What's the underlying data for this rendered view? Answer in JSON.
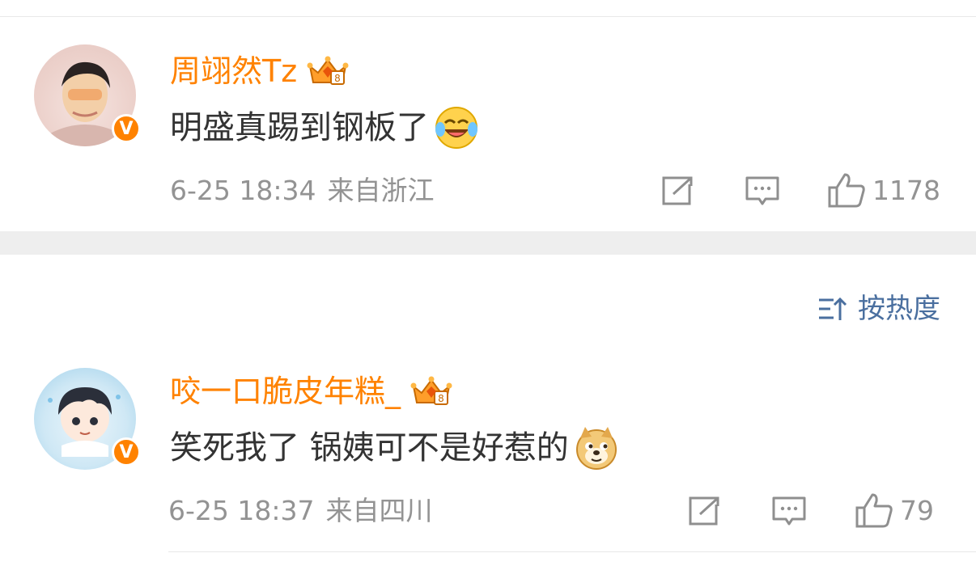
{
  "comments": [
    {
      "username": "周翊然Tz",
      "badge": "V",
      "text": "明盛真踢到钢板了",
      "emoji": "laughing-tears-emoji",
      "date": "6-25 18:34",
      "location": "来自浙江",
      "likes": "1178"
    },
    {
      "username": "咬一口脆皮年糕_",
      "badge": "V",
      "text": "笑死我了 锅姨可不是好惹的",
      "emoji": "doge-emoji",
      "date": "6-25 18:37",
      "location": "来自四川",
      "likes": "79"
    }
  ],
  "sort": {
    "label": "按热度"
  },
  "colors": {
    "username": "#ff8200",
    "meta": "#939393",
    "sort": "#4a6f9f",
    "text": "#333333"
  }
}
